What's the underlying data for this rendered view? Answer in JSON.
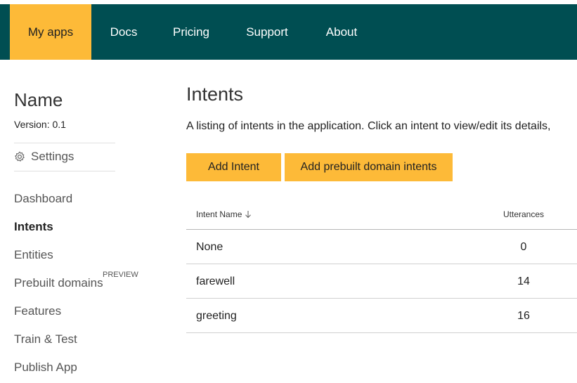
{
  "nav": {
    "items": [
      {
        "label": "My apps"
      },
      {
        "label": "Docs"
      },
      {
        "label": "Pricing"
      },
      {
        "label": "Support"
      },
      {
        "label": "About"
      }
    ]
  },
  "sidebar": {
    "app_name": "Name",
    "version": "Version:  0.1",
    "settings_label": "Settings",
    "links": [
      {
        "label": "Dashboard"
      },
      {
        "label": "Intents"
      },
      {
        "label": "Entities"
      },
      {
        "label": "Prebuilt domains"
      },
      {
        "label": "Features"
      },
      {
        "label": "Train & Test"
      },
      {
        "label": "Publish App"
      }
    ],
    "preview_tag": "PREVIEW"
  },
  "main": {
    "title": "Intents",
    "description": "A listing of intents in the application. Click an intent to view/edit its details,",
    "buttons": {
      "add_intent": "Add Intent",
      "add_prebuilt": "Add prebuilt domain intents"
    },
    "table": {
      "headers": {
        "name": "Intent Name",
        "utterances": "Utterances"
      },
      "rows": [
        {
          "name": "None",
          "utterances": "0"
        },
        {
          "name": "farewell",
          "utterances": "14"
        },
        {
          "name": "greeting",
          "utterances": "16"
        }
      ]
    }
  },
  "colors": {
    "topbar": "#004e52",
    "accent": "#fdba38"
  },
  "icons": {
    "settings": "gear-icon",
    "sort": "arrow-down-icon"
  }
}
